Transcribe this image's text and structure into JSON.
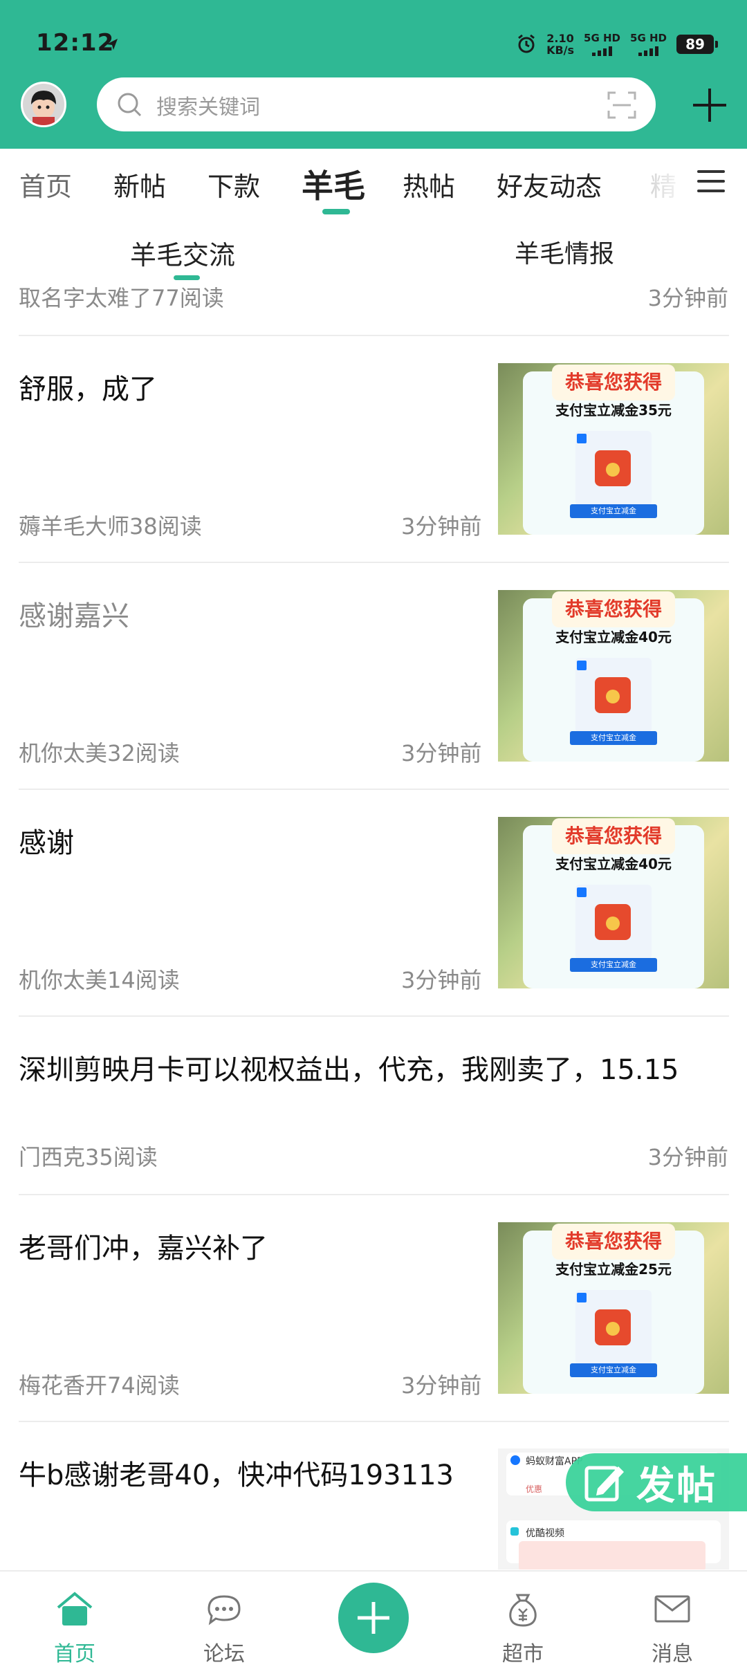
{
  "colors": {
    "primary": "#2fb894",
    "text": "#111111",
    "muted": "#8a8a8a",
    "fab": "#3bd39b"
  },
  "status_bar": {
    "time": "12:12",
    "net_speed_value": "2.10",
    "net_speed_unit": "KB/s",
    "sim1": "5G HD",
    "sim2": "5G HD",
    "battery": "89"
  },
  "header": {
    "search_placeholder": "搜索关键词"
  },
  "tabs": [
    {
      "label": "首页"
    },
    {
      "label": "新帖"
    },
    {
      "label": "下款"
    },
    {
      "label": "羊毛",
      "active": true
    },
    {
      "label": "热帖"
    },
    {
      "label": "好友动态"
    },
    {
      "label": "精"
    }
  ],
  "subtabs": [
    {
      "label": "羊毛交流",
      "active": true
    },
    {
      "label": "羊毛情报"
    }
  ],
  "partial_item": {
    "meta": "取名字太难了77阅读",
    "time": "3分钟前"
  },
  "posts": [
    {
      "title": "舒服，成了",
      "meta": "薅羊毛大师38阅读",
      "time": "3分钟前",
      "read": false,
      "thumb": {
        "banner": "恭喜您获得",
        "amount": "支付宝立减金35元",
        "button": "支付宝立减金"
      }
    },
    {
      "title": "感谢嘉兴",
      "meta": "机你太美32阅读",
      "time": "3分钟前",
      "read": true,
      "thumb": {
        "banner": "恭喜您获得",
        "amount": "支付宝立减金40元",
        "button": "支付宝立减金"
      }
    },
    {
      "title": "感谢",
      "meta": "机你太美14阅读",
      "time": "3分钟前",
      "read": false,
      "thumb": {
        "banner": "恭喜您获得",
        "amount": "支付宝立减金40元",
        "button": "支付宝立减金"
      }
    },
    {
      "title": "深圳剪映月卡可以视权益出，代充，我刚卖了，15.15",
      "meta": "门西克35阅读",
      "time": "3分钟前",
      "read": false
    },
    {
      "title": "老哥们冲，嘉兴补了",
      "meta": "梅花香开74阅读",
      "time": "3分钟前",
      "read": false,
      "thumb": {
        "banner": "恭喜您获得",
        "amount": "支付宝立减金25元",
        "button": "支付宝立减金"
      }
    },
    {
      "title": "牛b感谢老哥40，快冲代码193113",
      "read": false,
      "thumb2": {
        "app1": "蚂蚁财富APP",
        "app2": "优酷视频",
        "tag": "优惠"
      }
    }
  ],
  "fab": {
    "label": "发帖"
  },
  "bottom_nav": [
    {
      "label": "首页",
      "active": true
    },
    {
      "label": "论坛"
    },
    {
      "label": "超市"
    },
    {
      "label": "消息"
    }
  ]
}
